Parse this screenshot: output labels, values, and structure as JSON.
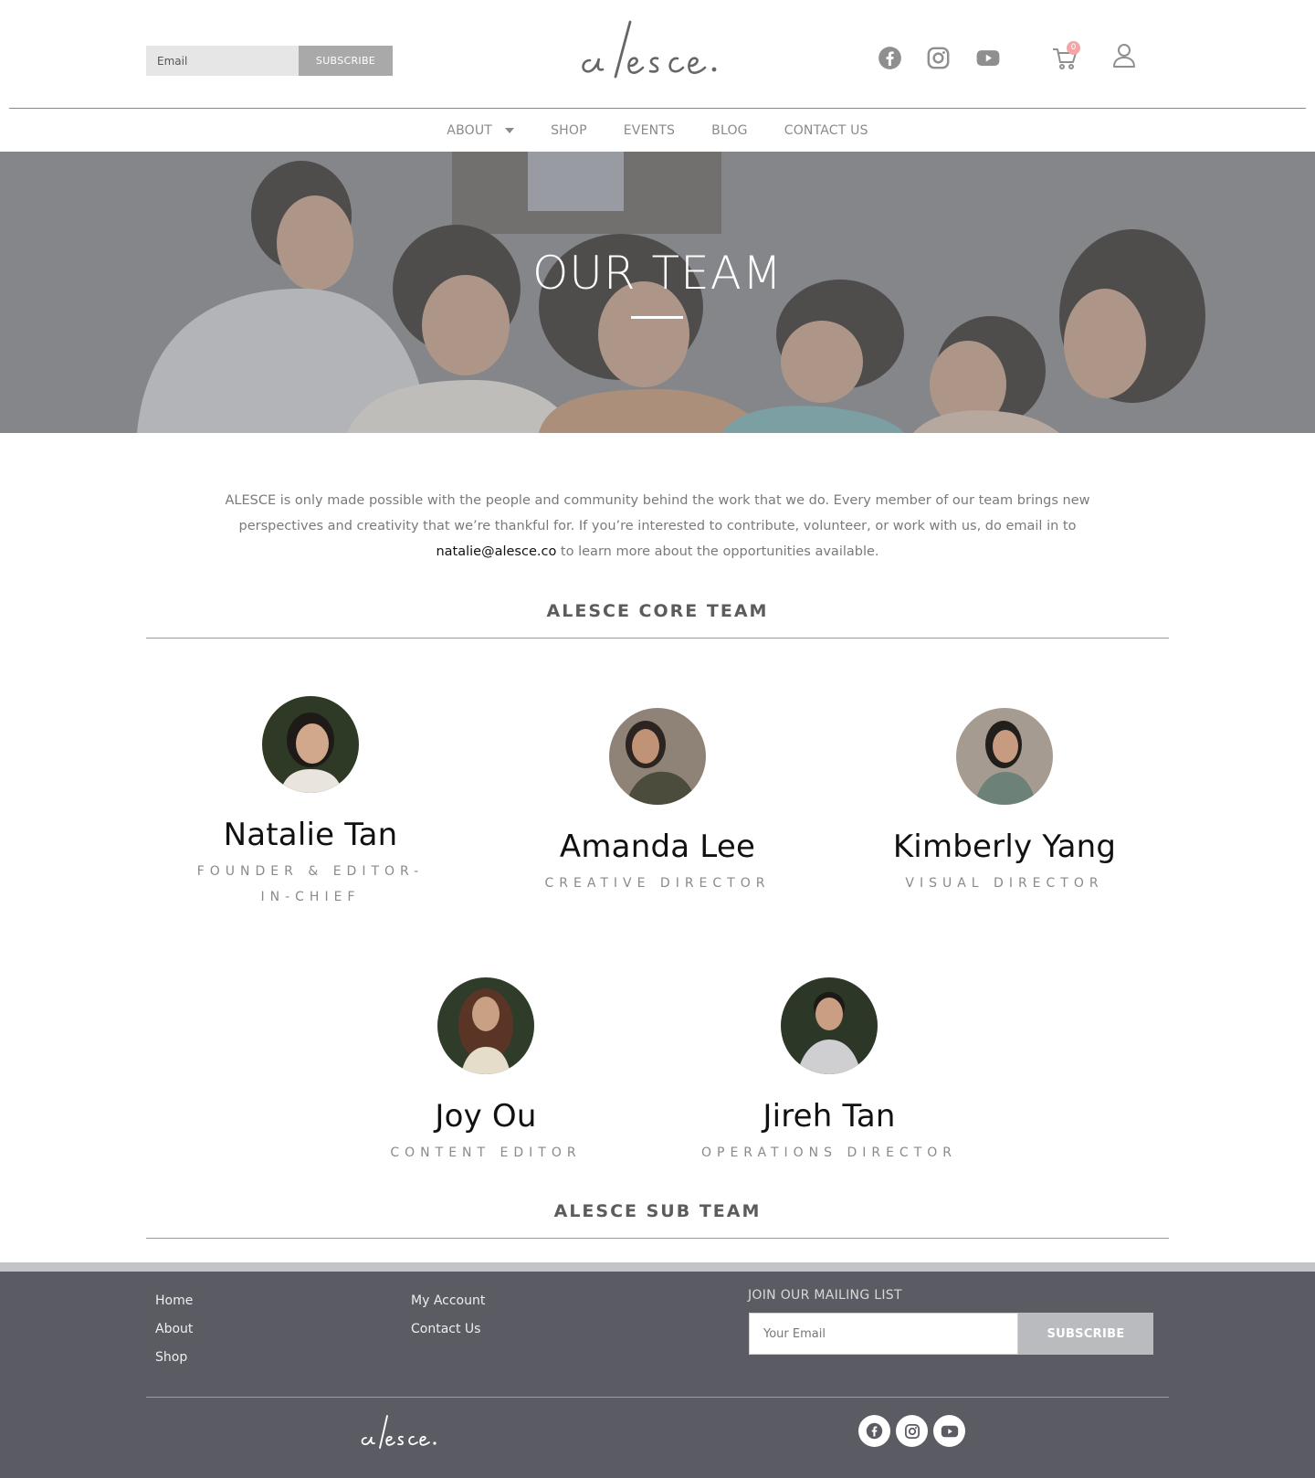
{
  "header": {
    "email_placeholder": "Email",
    "subscribe_label": "SUBSCRIBE",
    "logo_text": "a/esce.",
    "cart_count": "0",
    "icons": [
      "facebook-icon",
      "instagram-icon",
      "youtube-icon",
      "cart-icon",
      "user-icon"
    ]
  },
  "nav": {
    "items": [
      "ABOUT",
      "SHOP",
      "EVENTS",
      "BLOG",
      "CONTACT US"
    ]
  },
  "hero": {
    "title": "OUR TEAM"
  },
  "intro": {
    "text_before": "ALESCE is only made possible with the people and community behind the work that we do. Every member of our team brings new perspectives and creativity that we’re thankful for. If you’re interested to contribute, volunteer, or work with us, do email in to ",
    "email": "natalie@alesce.co",
    "text_after": " to learn more about the opportunities available."
  },
  "core_team": {
    "title": "ALESCE CORE TEAM",
    "members": [
      {
        "name": "Natalie Tan",
        "role": "FOUNDER & EDITOR-IN-CHIEF"
      },
      {
        "name": "Amanda Lee",
        "role": "CREATIVE DIRECTOR"
      },
      {
        "name": "Kimberly Yang",
        "role": "VISUAL DIRECTOR"
      },
      {
        "name": "Joy Ou",
        "role": "CONTENT EDITOR"
      },
      {
        "name": "Jireh Tan",
        "role": "OPERATIONS DIRECTOR"
      }
    ]
  },
  "sub_team": {
    "title": "ALESCE SUB TEAM"
  },
  "footer": {
    "col1": [
      "Home",
      "About",
      "Shop"
    ],
    "col2": [
      "My Account",
      "Contact Us"
    ],
    "mailing_title": "JOIN OUR MAILING LIST",
    "email_placeholder": "Your Email",
    "subscribe_label": "SUBSCRIBE",
    "logo_text": "a/esce."
  },
  "colors": {
    "footer_bg": "#5b5c63",
    "badge": "#f2a6a6",
    "text_gray": "#7a7a7a"
  }
}
